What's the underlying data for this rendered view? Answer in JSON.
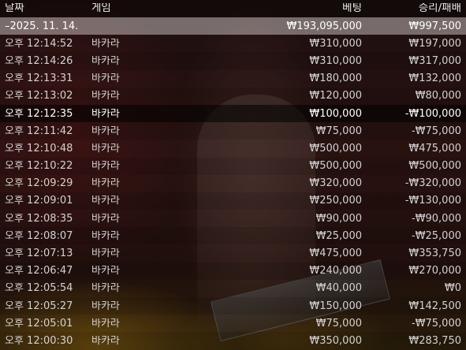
{
  "header": {
    "date": "날짜",
    "game": "게임",
    "bet": "베팅",
    "winloss": "승리/패배"
  },
  "summary": {
    "date": "–2025. 11. 14.",
    "bet": "₩193,095,000",
    "winloss": "₩997,500"
  },
  "rows": [
    {
      "time": "오후 12:14:52",
      "game": "바카라",
      "bet": "₩310,000",
      "winloss": "₩197,000"
    },
    {
      "time": "오후 12:14:26",
      "game": "바카라",
      "bet": "₩310,000",
      "winloss": "₩317,000"
    },
    {
      "time": "오후 12:13:31",
      "game": "바카라",
      "bet": "₩180,000",
      "winloss": "₩132,000"
    },
    {
      "time": "오후 12:13:02",
      "game": "바카라",
      "bet": "₩120,000",
      "winloss": "₩80,000"
    },
    {
      "time": "오후 12:12:35",
      "game": "바카라",
      "bet": "₩100,000",
      "winloss": "-₩100,000"
    },
    {
      "time": "오후 12:11:42",
      "game": "바카라",
      "bet": "₩75,000",
      "winloss": "-₩75,000"
    },
    {
      "time": "오후 12:10:48",
      "game": "바카라",
      "bet": "₩500,000",
      "winloss": "₩475,000"
    },
    {
      "time": "오후 12:10:22",
      "game": "바카라",
      "bet": "₩500,000",
      "winloss": "₩500,000"
    },
    {
      "time": "오후 12:09:29",
      "game": "바카라",
      "bet": "₩320,000",
      "winloss": "-₩320,000"
    },
    {
      "time": "오후 12:09:01",
      "game": "바카라",
      "bet": "₩250,000",
      "winloss": "-₩130,000"
    },
    {
      "time": "오후 12:08:35",
      "game": "바카라",
      "bet": "₩90,000",
      "winloss": "-₩90,000"
    },
    {
      "time": "오후 12:08:07",
      "game": "바카라",
      "bet": "₩25,000",
      "winloss": "-₩25,000"
    },
    {
      "time": "오후 12:07:13",
      "game": "바카라",
      "bet": "₩475,000",
      "winloss": "₩353,750"
    },
    {
      "time": "오후 12:06:47",
      "game": "바카라",
      "bet": "₩240,000",
      "winloss": "₩270,000"
    },
    {
      "time": "오후 12:05:54",
      "game": "바카라",
      "bet": "₩40,000",
      "winloss": "₩0"
    },
    {
      "time": "오후 12:05:27",
      "game": "바카라",
      "bet": "₩150,000",
      "winloss": "₩142,500"
    },
    {
      "time": "오후 12:05:01",
      "game": "바카라",
      "bet": "₩75,000",
      "winloss": "-₩75,000"
    },
    {
      "time": "오후 12:00:30",
      "game": "바카라",
      "bet": "₩350,000",
      "winloss": "₩283,750"
    }
  ]
}
